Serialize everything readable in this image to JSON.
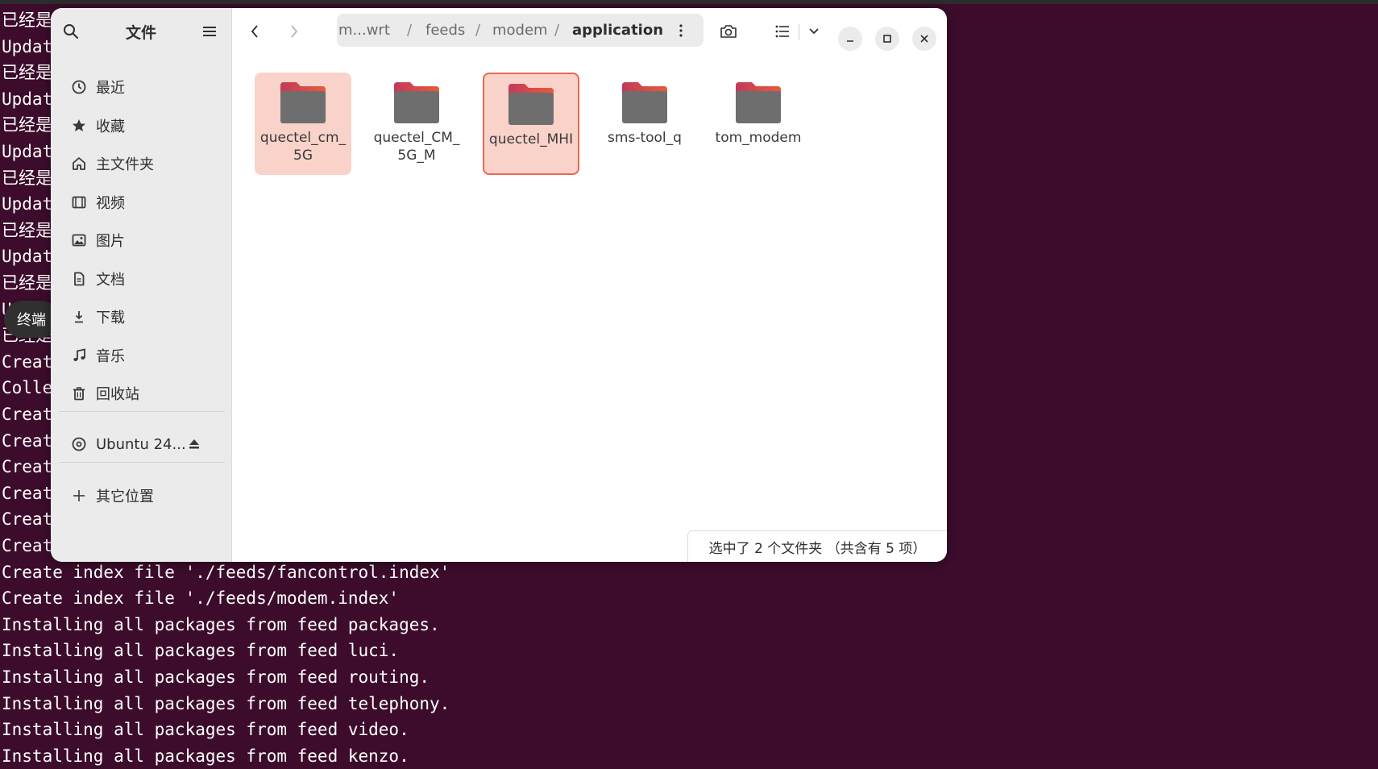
{
  "terminal": {
    "tooltip": "终端",
    "lines": [
      {
        "text": "已经是",
        "zh": true
      },
      {
        "text": "Updat",
        "zh": false
      },
      {
        "text": "已经是",
        "zh": true
      },
      {
        "text": "Updat",
        "zh": false
      },
      {
        "text": "已经是",
        "zh": true
      },
      {
        "text": "Updat",
        "zh": false
      },
      {
        "text": "已经是",
        "zh": true
      },
      {
        "text": "Updat",
        "zh": false
      },
      {
        "text": "已经是",
        "zh": true
      },
      {
        "text": "Updat",
        "zh": false
      },
      {
        "text": "已经是",
        "zh": true
      },
      {
        "text": "U",
        "zh": false
      },
      {
        "text": "已经是",
        "zh": true
      },
      {
        "text": "Creat",
        "zh": false
      },
      {
        "text": "Colle",
        "zh": false
      },
      {
        "text": "Creat",
        "zh": false
      },
      {
        "text": "Creat",
        "zh": false
      },
      {
        "text": "Creat",
        "zh": false
      },
      {
        "text": "Creat",
        "zh": false
      },
      {
        "text": "Creat",
        "zh": false
      },
      {
        "text": "Creat",
        "zh": false
      },
      {
        "text": "Create index file './feeds/fancontrol.index'",
        "zh": false
      },
      {
        "text": "Create index file './feeds/modem.index'",
        "zh": false
      },
      {
        "text": "Installing all packages from feed packages.",
        "zh": false
      },
      {
        "text": "Installing all packages from feed luci.",
        "zh": false
      },
      {
        "text": "Installing all packages from feed routing.",
        "zh": false
      },
      {
        "text": "Installing all packages from feed telephony.",
        "zh": false
      },
      {
        "text": "Installing all packages from feed video.",
        "zh": false
      },
      {
        "text": "Installing all packages from feed kenzo.",
        "zh": false
      }
    ]
  },
  "sidebar": {
    "title": "文件",
    "search_icon": "search-icon",
    "menu_icon": "hamburger-menu-icon",
    "items": [
      {
        "label": "最近",
        "icon": "clock-icon"
      },
      {
        "label": "收藏",
        "icon": "star-icon"
      },
      {
        "label": "主文件夹",
        "icon": "home-icon"
      },
      {
        "label": "视频",
        "icon": "film-icon"
      },
      {
        "label": "图片",
        "icon": "image-icon"
      },
      {
        "label": "文档",
        "icon": "document-icon"
      },
      {
        "label": "下载",
        "icon": "download-icon"
      },
      {
        "label": "音乐",
        "icon": "music-icon"
      },
      {
        "label": "回收站",
        "icon": "trash-icon"
      }
    ],
    "device": {
      "label": "Ubuntu 24...",
      "icon": "disc-icon",
      "eject_icon": "eject-icon"
    },
    "other": {
      "label": "其它位置",
      "icon": "plus-icon"
    }
  },
  "pathbar": {
    "crumbs": [
      "m...wrt",
      "feeds",
      "modem",
      "application"
    ],
    "separator": "/"
  },
  "files": [
    {
      "name": "quectel_cm_5G",
      "selected": true,
      "focused": false
    },
    {
      "name": "quectel_CM_5G_M",
      "selected": false,
      "focused": false
    },
    {
      "name": "quectel_MHI",
      "selected": true,
      "focused": true
    },
    {
      "name": "sms-tool_q",
      "selected": false,
      "focused": false
    },
    {
      "name": "tom_modem",
      "selected": false,
      "focused": false
    }
  ],
  "status": "选中了 2 个文件夹 （共含有 5 项）",
  "colors": {
    "folder_top": "#e95b3a",
    "folder_top2": "#c23a5a",
    "folder_body": "#6e6e6e",
    "selection": "#f9d2c9",
    "focus": "#e66a52",
    "terminal_bg": "#3d0c2c"
  }
}
